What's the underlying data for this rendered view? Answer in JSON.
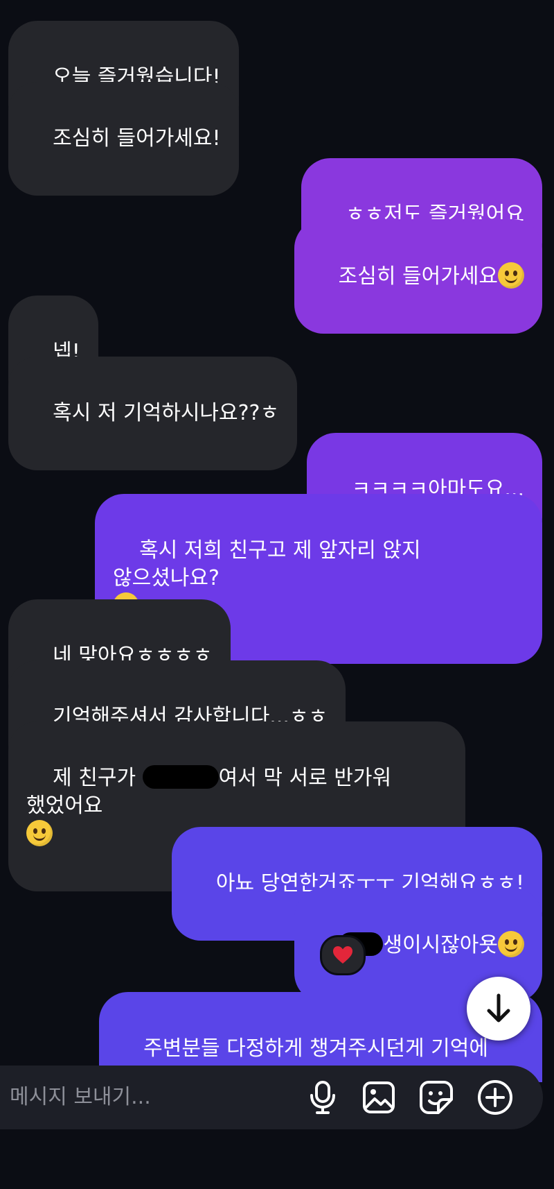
{
  "messages": [
    {
      "side": "in",
      "text": "오늘 즐거웠습니다!"
    },
    {
      "side": "in",
      "text": "조심히 들어가세요!"
    },
    {
      "side": "out",
      "text": "ㅎㅎ저도 즐거웠어요"
    },
    {
      "side": "out",
      "text": "조심히 들어가세요",
      "emoji": "relieved-face"
    },
    {
      "side": "in",
      "text": "넵!"
    },
    {
      "side": "in",
      "text": "혹시 저 기억하시나요??ㅎ"
    },
    {
      "side": "out",
      "text": "ㅋㅋㅋㅋ아마도요..."
    },
    {
      "side": "out",
      "text_line1": "혹시 저희 친구고 제 앞자리 앉지 않으셨나요?",
      "emoji": "pleading-face"
    },
    {
      "side": "in",
      "text": "네 맞아요ㅎㅎㅎㅎ"
    },
    {
      "side": "in",
      "text": "기억해주셔서 감사합니다...ㅎㅎ"
    },
    {
      "side": "in",
      "text_before": "제 친구가 ",
      "text_after": "여서 막 서로 반가워 했었어요",
      "emoji": "grinning-squinting-face"
    },
    {
      "side": "out",
      "text": "아뇨 당연한거죠ㅜㅜ 기억해요ㅎㅎ!"
    },
    {
      "side": "out",
      "text_after": "생이시잖아욧",
      "emoji": "smiling-face",
      "reaction": "heart"
    },
    {
      "side": "out",
      "text": "주변분들 다정하게 챙겨주시던게 기억에\n요!"
    }
  ],
  "composer": {
    "placeholder": "메시지 보내기...",
    "icons": [
      "microphone-icon",
      "image-icon",
      "sticker-icon",
      "add-circle-icon"
    ]
  },
  "colors": {
    "background": "#0b0d14",
    "incoming_bubble": "#25262b",
    "outgoing_bubble_top": "#8a38de",
    "outgoing_bubble_bottom": "#5a45e8"
  }
}
